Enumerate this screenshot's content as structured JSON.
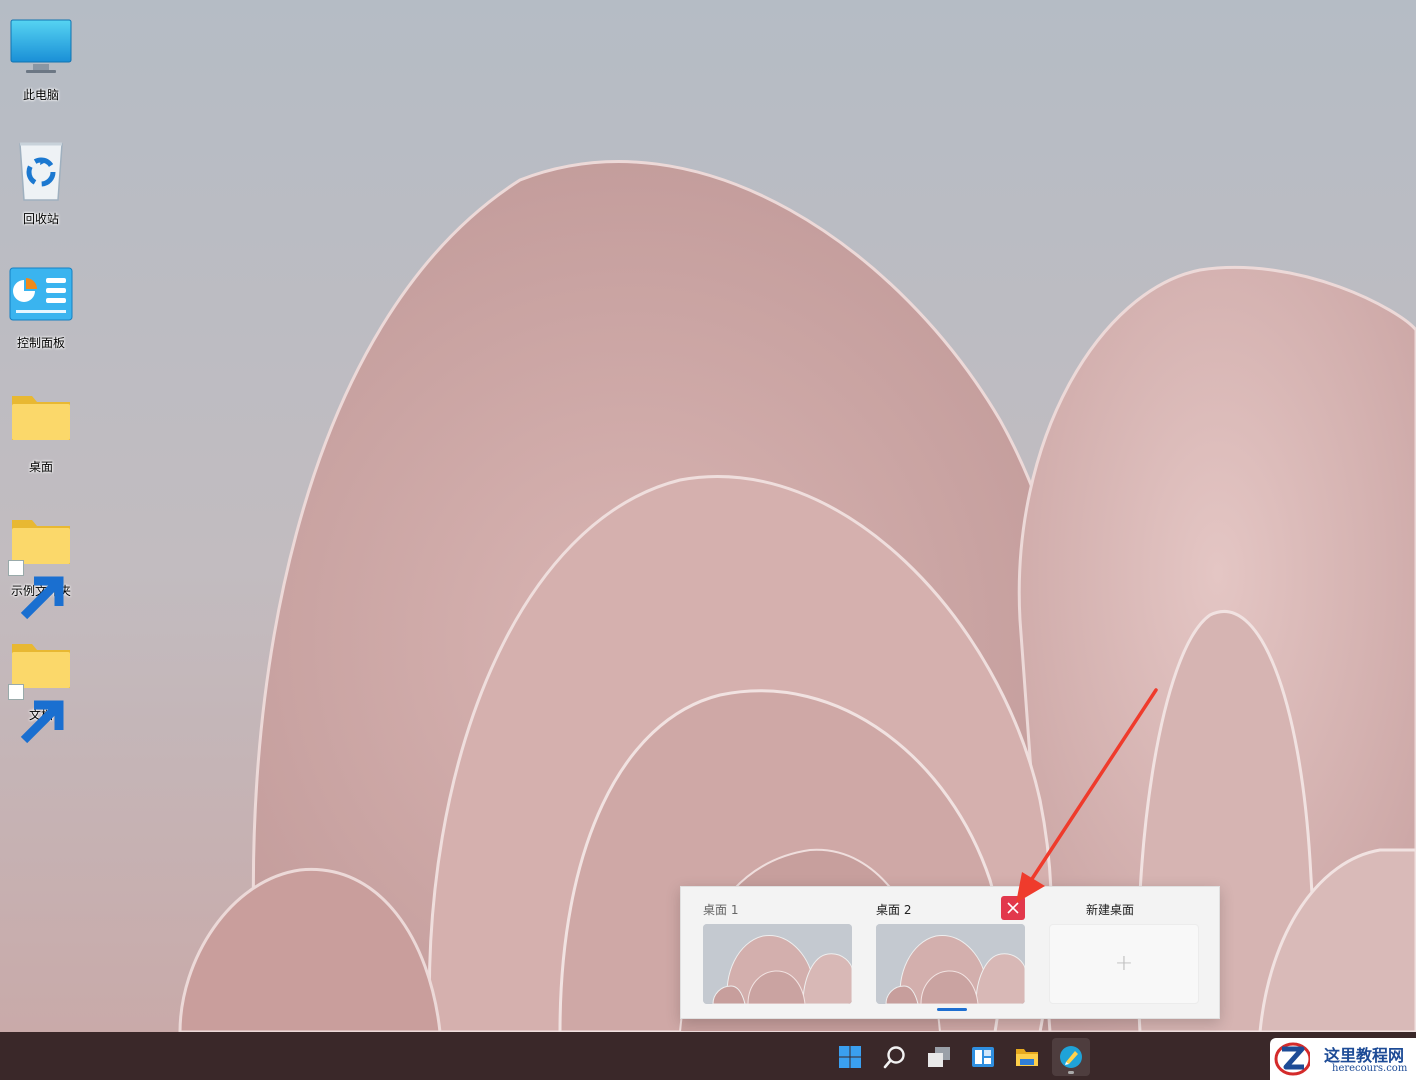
{
  "desktop": {
    "icons": [
      {
        "label": "此电脑"
      },
      {
        "label": "回收站"
      },
      {
        "label": "控制面板"
      },
      {
        "label": "桌面"
      },
      {
        "label": "示例文件夹"
      },
      {
        "label": "文档"
      }
    ]
  },
  "task_view": {
    "desktops": [
      {
        "label": "桌面 1"
      },
      {
        "label": "桌面 2"
      }
    ],
    "new_desktop_label": "新建桌面",
    "new_desktop_plus": "+",
    "close_icon": "close-icon"
  },
  "taskbar": {
    "items": [
      "windows-start-icon",
      "search-icon",
      "task-view-icon",
      "widgets-icon",
      "file-explorer-icon",
      "app-icon"
    ]
  },
  "watermark": {
    "title": "这里教程网",
    "url": "herecours.com"
  },
  "colors": {
    "close_button": "#e2384c",
    "active_indicator": "#1e6fd1",
    "arrow": "#ef3b2c",
    "taskbar": "#3a2829"
  }
}
